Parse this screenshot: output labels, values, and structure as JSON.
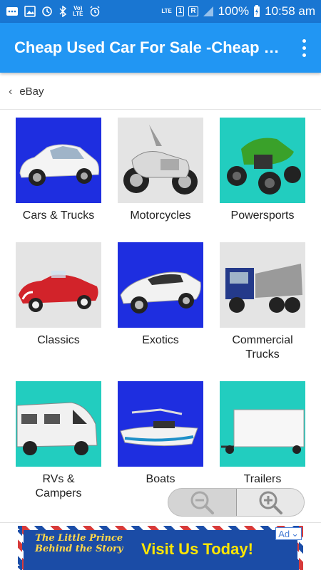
{
  "status_bar": {
    "lte_label": "LTE",
    "sim_slot": "1",
    "roaming": "R",
    "battery_percent": "100%",
    "time": "10:58 am",
    "volte": "Vo)\nLTE"
  },
  "app_bar": {
    "title": "Cheap Used Car For Sale -Cheap Car",
    "menu_icon": "more-vert-icon"
  },
  "breadcrumb": {
    "label": "eBay",
    "back_icon": "chevron-left-icon"
  },
  "categories": [
    {
      "label": "Cars & Trucks"
    },
    {
      "label": "Motorcycles"
    },
    {
      "label": "Powersports"
    },
    {
      "label": "Classics"
    },
    {
      "label": "Exotics"
    },
    {
      "label": "Commercial\nTrucks"
    },
    {
      "label": "RVs &\nCampers"
    },
    {
      "label": "Boats"
    },
    {
      "label": "Trailers"
    }
  ],
  "colors": {
    "status_bar": "#1976d2",
    "app_bar": "#2196f3",
    "tile_blue": "#1e2ee0",
    "tile_gray": "#e4e4e4",
    "tile_teal": "#22cdbf"
  },
  "zoom_controls": {
    "zoom_out_icon": "zoom-out-icon",
    "zoom_in_icon": "zoom-in-icon"
  },
  "ad": {
    "brand_line1": "The Little Prince",
    "brand_line2": "Behind the Story",
    "cta": "Visit Us Today!",
    "badge": "Ad"
  }
}
